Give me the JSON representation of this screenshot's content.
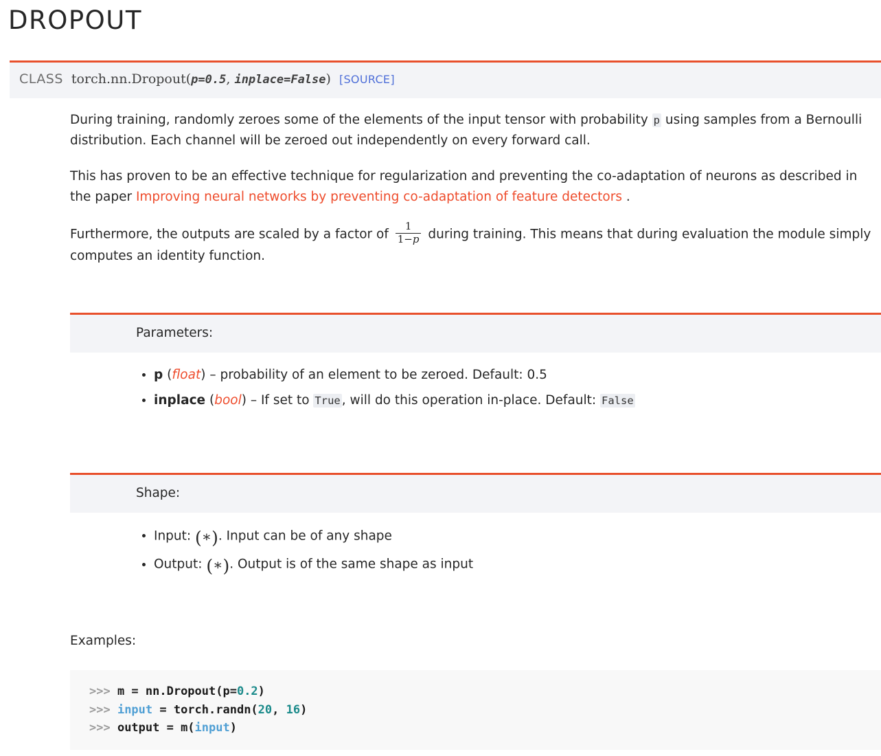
{
  "page": {
    "title": "DROPOUT"
  },
  "signature": {
    "class_label": "CLASS",
    "qualified_name": "torch.nn.Dropout",
    "open_paren": "(",
    "param_p": "p=0.5",
    "comma": ", ",
    "param_inplace": "inplace=False",
    "close_paren": ")",
    "source_link": "[SOURCE]"
  },
  "paragraphs": {
    "p1_before_code": "During training, randomly zeroes some of the elements of the input tensor with probability ",
    "p1_code": "p",
    "p1_after_code": " using samples from a Bernoulli distribution. Each channel will be zeroed out independently on every forward call.",
    "p2_before_link": "This has proven to be an effective technique for regularization and preventing the co-adaptation of neurons as described in the paper ",
    "p2_link": "Improving neural networks by preventing co-adaptation of feature detectors",
    "p2_after_link": " .",
    "p3_before_math": "Furthermore, the outputs are scaled by a factor of ",
    "p3_frac_numerator": "1",
    "p3_frac_denominator_lhs": "1",
    "p3_frac_denominator_op": "−",
    "p3_frac_denominator_rhs": "p",
    "p3_after_math": " during training. This means that during evaluation the module simply computes an identity function."
  },
  "parameters_section": {
    "heading": "Parameters:",
    "items": [
      {
        "name": "p",
        "type": "(float)",
        "type_open": "(",
        "type_text": "float",
        "type_close": ")",
        "desc_before_code": " – probability of an element to be zeroed. Default: 0.5",
        "code": "",
        "desc_after_code": ""
      },
      {
        "name": "inplace",
        "type": "(bool)",
        "type_open": "(",
        "type_text": "bool",
        "type_close": ")",
        "desc_before_code": " – If set to ",
        "code": "True",
        "desc_mid": ", will do this operation in-place. Default: ",
        "code2": "False",
        "desc_after_code": ""
      }
    ]
  },
  "shape_section": {
    "heading": "Shape:",
    "items": [
      {
        "label": "Input: ",
        "math_open": "(",
        "math_star": "∗",
        "math_close": ")",
        "desc": ". Input can be of any shape"
      },
      {
        "label": "Output: ",
        "math_open": "(",
        "math_star": "∗",
        "math_close": ")",
        "desc": ". Output is of the same shape as input"
      }
    ]
  },
  "examples_section": {
    "label": "Examples:",
    "lines": [
      [
        {
          "t": ">>> ",
          "c": "prompt"
        },
        {
          "t": "m = nn.Dropout(p=",
          "c": "plain"
        },
        {
          "t": "0.2",
          "c": "num"
        },
        {
          "t": ")",
          "c": "plain"
        }
      ],
      [
        {
          "t": ">>> ",
          "c": "prompt"
        },
        {
          "t": "input",
          "c": "name"
        },
        {
          "t": " = torch.randn(",
          "c": "plain"
        },
        {
          "t": "20",
          "c": "num"
        },
        {
          "t": ", ",
          "c": "plain"
        },
        {
          "t": "16",
          "c": "num"
        },
        {
          "t": ")",
          "c": "plain"
        }
      ],
      [
        {
          "t": ">>> ",
          "c": "prompt"
        },
        {
          "t": "output = m(",
          "c": "plain"
        },
        {
          "t": "input",
          "c": "name"
        },
        {
          "t": ")",
          "c": "plain"
        }
      ]
    ]
  },
  "colors": {
    "accent_orange": "#ee4c2c",
    "border_orange": "#e8502c",
    "panel_gray": "#f3f4f7",
    "code_bg": "#f8f8f8",
    "link_blue": "#4f6fd8",
    "text": "#262626"
  }
}
